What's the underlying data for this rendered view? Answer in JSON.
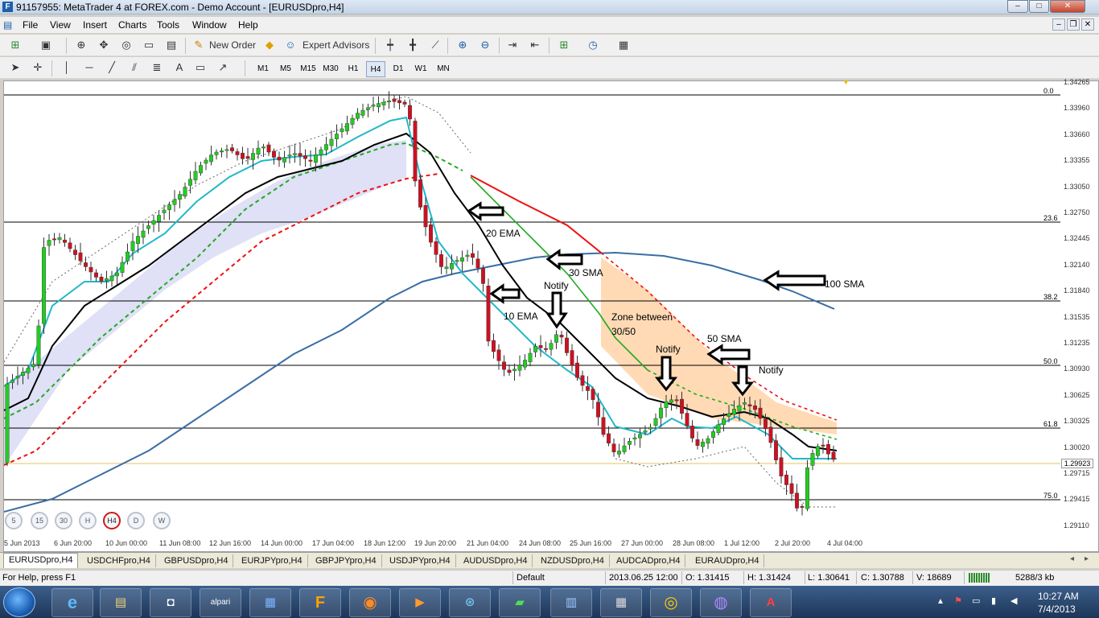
{
  "window": {
    "title": "91157955: MetaTrader 4 at FOREX.com - Demo Account - [EURUSDpro,H4]",
    "app_icon": "F",
    "buttons": {
      "minimize": "–",
      "maximize": "□",
      "close": "✕"
    }
  },
  "menu": [
    "File",
    "View",
    "Insert",
    "Charts",
    "Tools",
    "Window",
    "Help"
  ],
  "toolbar": {
    "new_order": "New Order",
    "expert_advisors": "Expert Advisors"
  },
  "timeframes": [
    "M1",
    "M5",
    "M15",
    "M30",
    "H1",
    "H4",
    "D1",
    "W1",
    "MN"
  ],
  "timeframe_selected": "H4",
  "chart": {
    "symbol": "EURUSDpro,H4",
    "y_labels": [
      "1.34265",
      "1.33960",
      "1.33660",
      "1.33355",
      "1.33050",
      "1.32750",
      "1.32445",
      "1.32140",
      "1.31840",
      "1.31535",
      "1.31235",
      "1.30930",
      "1.30625",
      "1.30325",
      "1.30020",
      "1.29715",
      "1.29415",
      "1.29110"
    ],
    "current_price": "1.29923",
    "x_labels": [
      "5 Jun 2013",
      "6 Jun 20:00",
      "10 Jun 00:00",
      "11 Jun 08:00",
      "12 Jun 16:00",
      "14 Jun 00:00",
      "17 Jun 04:00",
      "18 Jun 12:00",
      "19 Jun 20:00",
      "21 Jun 04:00",
      "24 Jun 08:00",
      "25 Jun 16:00",
      "27 Jun 00:00",
      "28 Jun 08:00",
      "1 Jul 12:00",
      "2 Jul 20:00",
      "4 Jul 04:00"
    ],
    "fib_levels": [
      "0.0",
      "23.6",
      "38.2",
      "50.0",
      "61.8",
      "75.0"
    ],
    "annotations": {
      "ema20": "20 EMA",
      "sma30": "30 SMA",
      "sma100": "100 SMA",
      "notify1": "Notify",
      "ema10": "10 EMA",
      "zone_line1": "Zone between",
      "zone_line2": "30/50",
      "sma50": "50 SMA",
      "notify2": "Notify",
      "notify3": "Notify"
    },
    "mini_buttons": [
      "5",
      "15",
      "30",
      "H",
      "H4",
      "D",
      "W"
    ],
    "mini_selected": "H4",
    "colors": {
      "bull": "#22cc22",
      "bear": "#cc1122",
      "ema10": "#22b8c8",
      "ema20": "#000000",
      "sma30": "#22aa22",
      "sma50": "#ee1111",
      "sma100": "#3a6ea5",
      "zone": "#ffcc99",
      "cloud": "#c8c8f0"
    }
  },
  "tabs": [
    "EURUSDpro,H4",
    "USDCHFpro,H4",
    "GBPUSDpro,H4",
    "EURJPYpro,H4",
    "GBPJPYpro,H4",
    "USDJPYpro,H4",
    "AUDUSDpro,H4",
    "NZDUSDpro,H4",
    "AUDCADpro,H4",
    "EURAUDpro,H4"
  ],
  "status": {
    "help": "For Help, press F1",
    "profile": "Default",
    "datetime": "2013.06.25 12:00",
    "open": "O: 1.31415",
    "high": "H: 1.31424",
    "low": "L: 1.30641",
    "close": "C: 1.30788",
    "volume": "V: 18689",
    "traffic": "5288/3 kb"
  },
  "taskbar": {
    "time": "10:27 AM",
    "date": "7/4/2013",
    "apps": [
      "internet-explorer",
      "file-explorer",
      "trading-app",
      "alpari",
      "app-blue",
      "forex-com",
      "firefox",
      "media-player",
      "ie-globe",
      "metatrader",
      "building-app",
      "calculator",
      "chrome",
      "media-ball",
      "acrobat"
    ],
    "alpari_label": "alpari"
  }
}
